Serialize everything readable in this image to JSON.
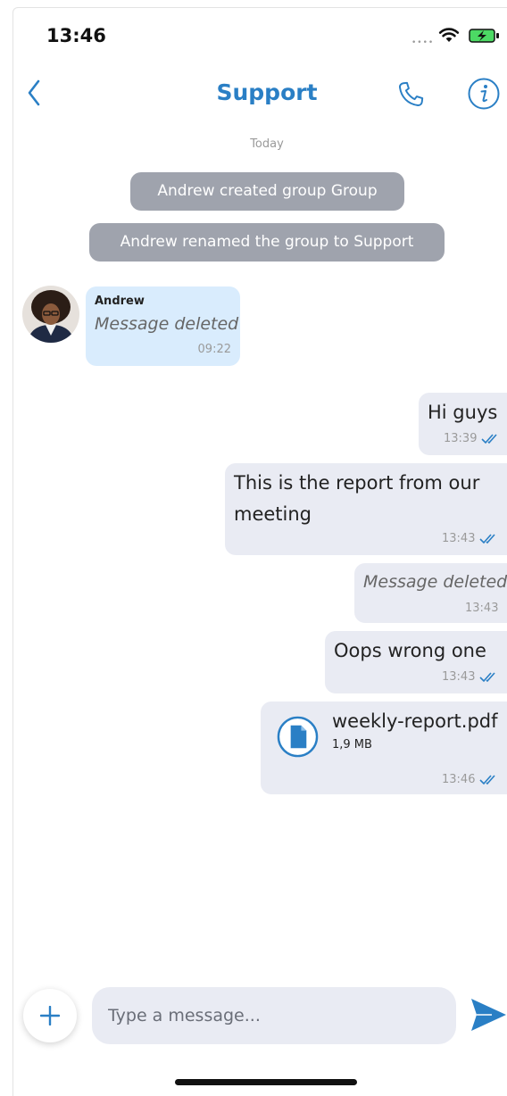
{
  "status_bar": {
    "time": "13:46",
    "signal": "••••"
  },
  "header": {
    "title": "Support",
    "back_icon": "chevron-left-icon",
    "call_icon": "phone-icon",
    "info_icon": "info-icon"
  },
  "date_separator": "Today",
  "system_messages": [
    "Andrew created group Group",
    "Andrew renamed the group to Support"
  ],
  "incoming": {
    "sender": "Andrew",
    "text": "Message deleted",
    "time": "09:22"
  },
  "outgoing": [
    {
      "lines": [
        "Hi guys"
      ],
      "time": "13:39"
    },
    {
      "lines": [
        "This is the report from our",
        "meeting"
      ],
      "time": "13:43"
    },
    {
      "lines": [
        "Message deleted"
      ],
      "time": "13:43"
    },
    {
      "lines": [
        "Oops wrong one"
      ],
      "time": "13:43"
    }
  ],
  "attachment": {
    "name": "weekly-report.pdf",
    "size": "1,9 MB",
    "time": "13:46",
    "icon": "file-icon"
  },
  "composer": {
    "placeholder": "Type a message...",
    "add_icon": "plus-icon",
    "send_icon": "send-icon"
  },
  "colors": {
    "accent": "#2a7fc5",
    "incoming_bubble": "#d9ecfd",
    "outgoing_bubble": "#e9ebf3",
    "system_bubble": "#9fa3ad"
  }
}
